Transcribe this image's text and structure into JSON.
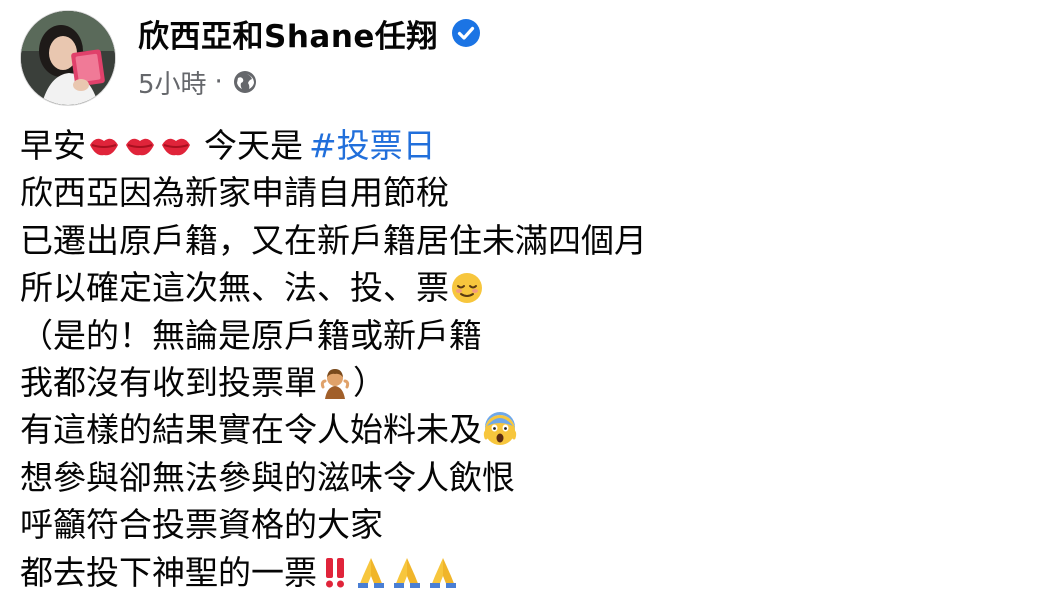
{
  "author": {
    "name": "欣西亞和Shane任翔",
    "verified": true
  },
  "meta": {
    "time": "5小時",
    "separator": "·",
    "audience_icon": "globe-icon"
  },
  "post": {
    "line1": {
      "greeting": "早安",
      "after": "今天是",
      "hashtag": "#投票日"
    },
    "line2": "欣西亞因為新家申請自用節稅",
    "line3": "已遷出原戶籍，又在新戶籍居住未滿四個月",
    "line4": "所以確定這次無、法、投、票",
    "line5": "（是的！無論是原戶籍或新戶籍",
    "line6": {
      "text": "我都沒有收到投票單",
      "after": "）"
    },
    "line7": "有這樣的結果實在令人始料未及",
    "line8": "想參與卻無法參與的滋味令人飲恨",
    "line9": "呼籲符合投票資格的大家",
    "line10": "都去投下神聖的一票"
  },
  "colors": {
    "hashtag": "#216fdb",
    "verified_badge": "#1b74e4",
    "meta_text": "#65676b"
  }
}
